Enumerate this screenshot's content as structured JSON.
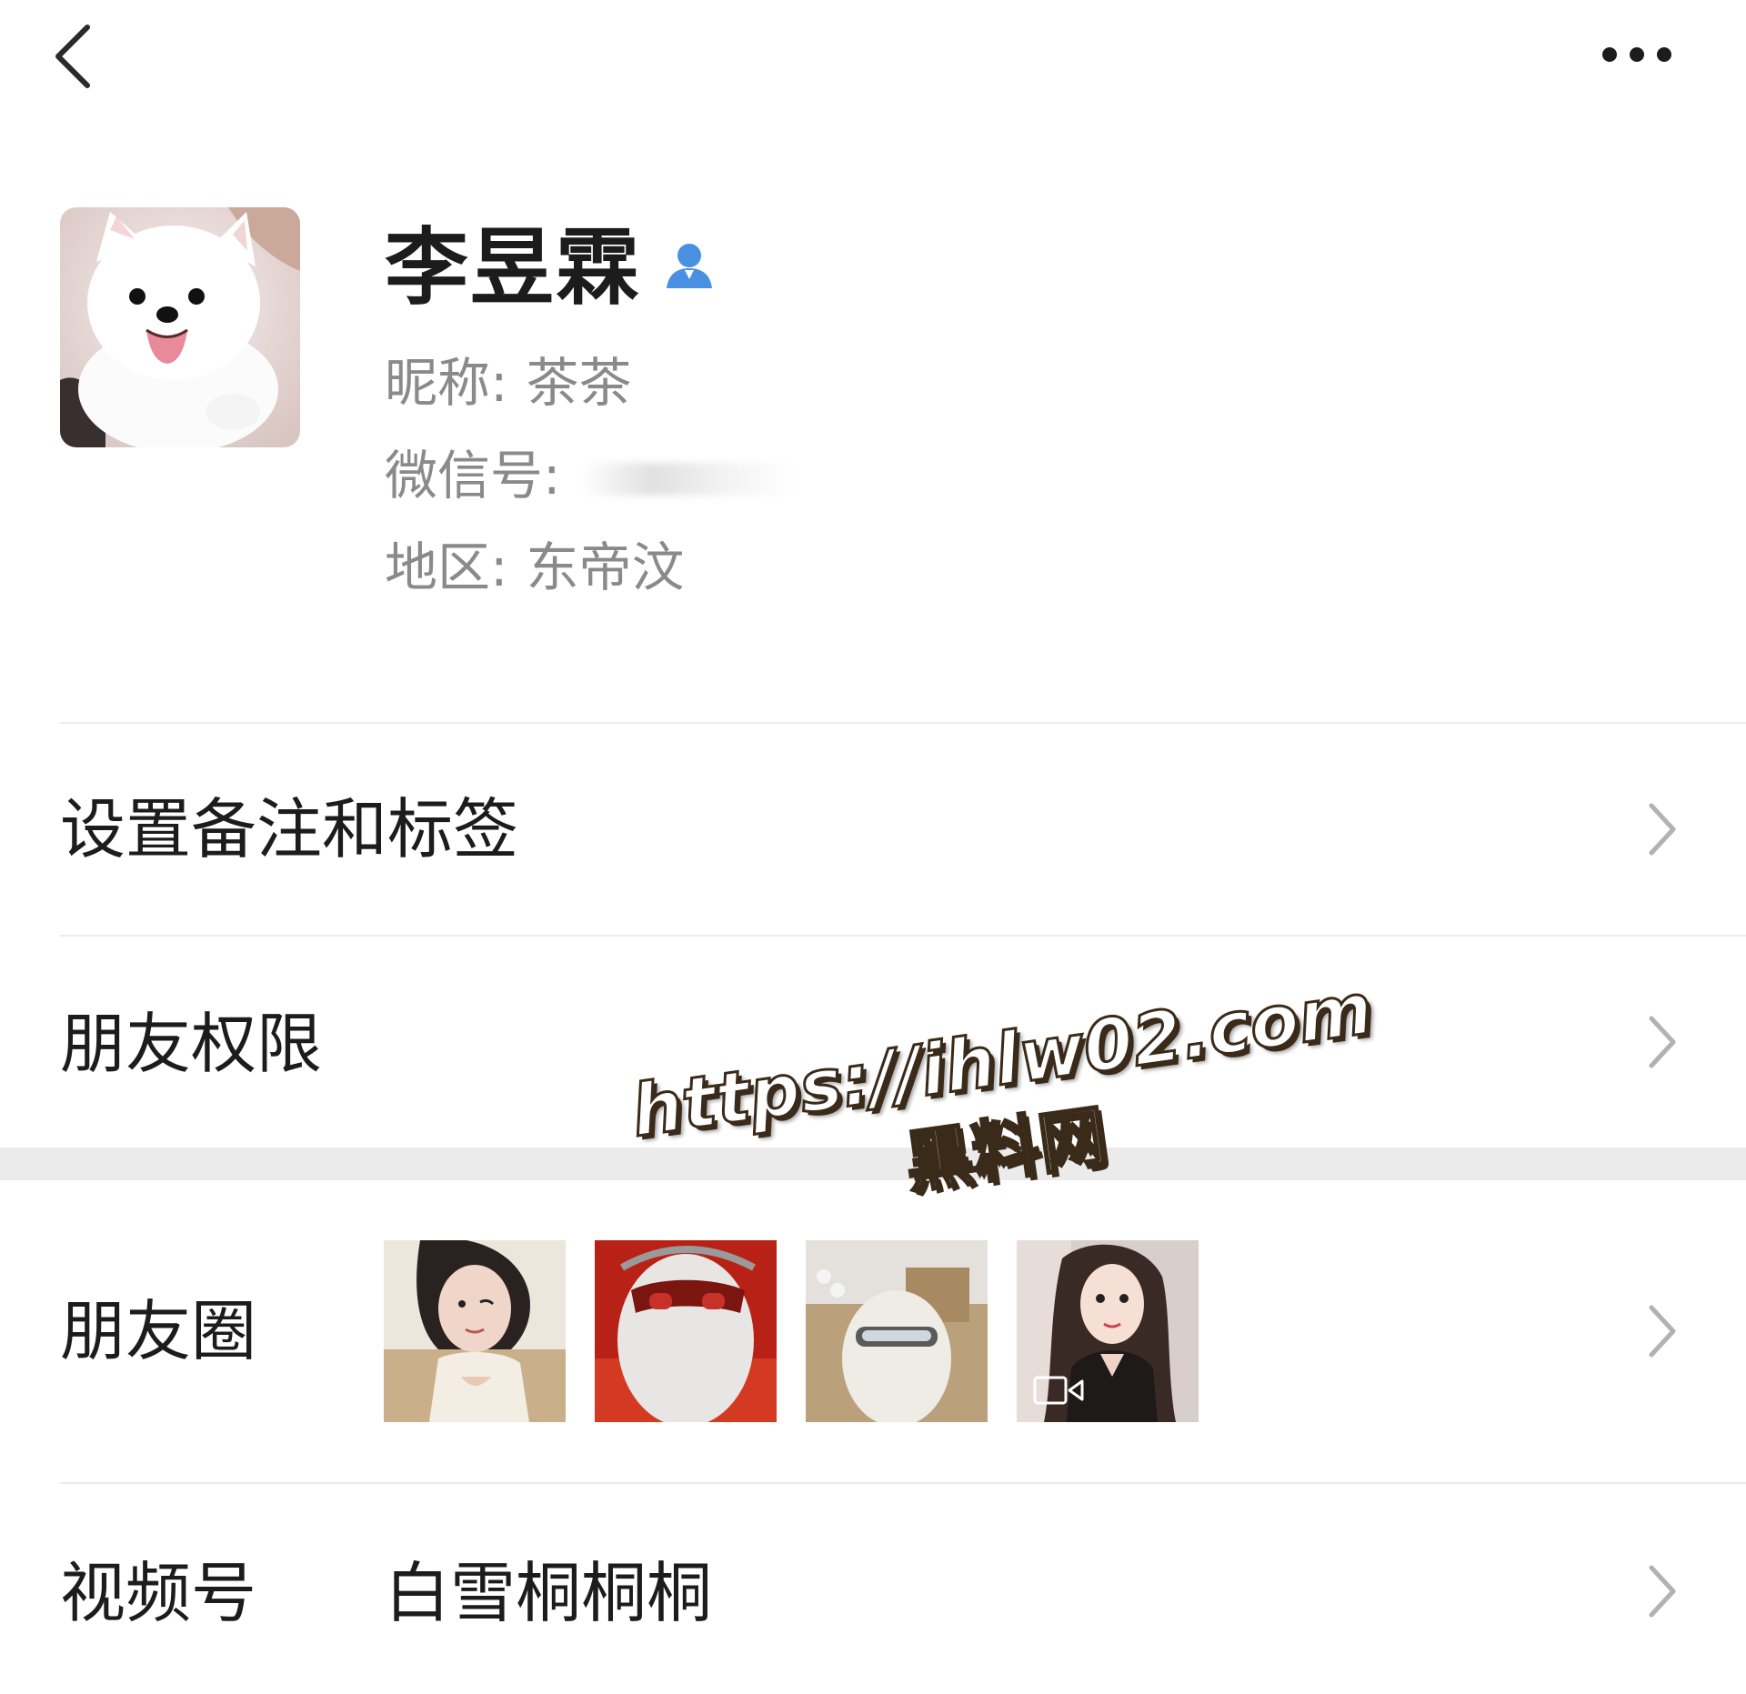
{
  "nav": {
    "back_icon": "chevron-left-icon",
    "more_icon": "more-dots-icon"
  },
  "profile": {
    "name": "李昱霖",
    "verify_icon": "contact-person-icon",
    "nickname_label": "昵称:",
    "nickname_value": "茶茶",
    "wechat_id_label": "微信号:",
    "region_label": "地区:",
    "region_value": "东帝汶",
    "avatar_icon": "avatar-dog-photo"
  },
  "rows": {
    "remark": {
      "label": "设置备注和标签"
    },
    "permissions": {
      "label": "朋友权限"
    },
    "moments": {
      "label": "朋友圈"
    },
    "channels": {
      "label": "视频号",
      "value": "白雪桐桐桐"
    }
  },
  "watermark": {
    "url": "https://ihlw02.com",
    "brand": "黑料网"
  },
  "colors": {
    "background": "#ffffff",
    "text_primary": "#1c1c1c",
    "text_secondary": "#8a8a8a",
    "divider": "#ececec",
    "section_gap": "#ebebeb",
    "verify_blue": "#4a90e2",
    "chevron": "#b2b2b2"
  }
}
